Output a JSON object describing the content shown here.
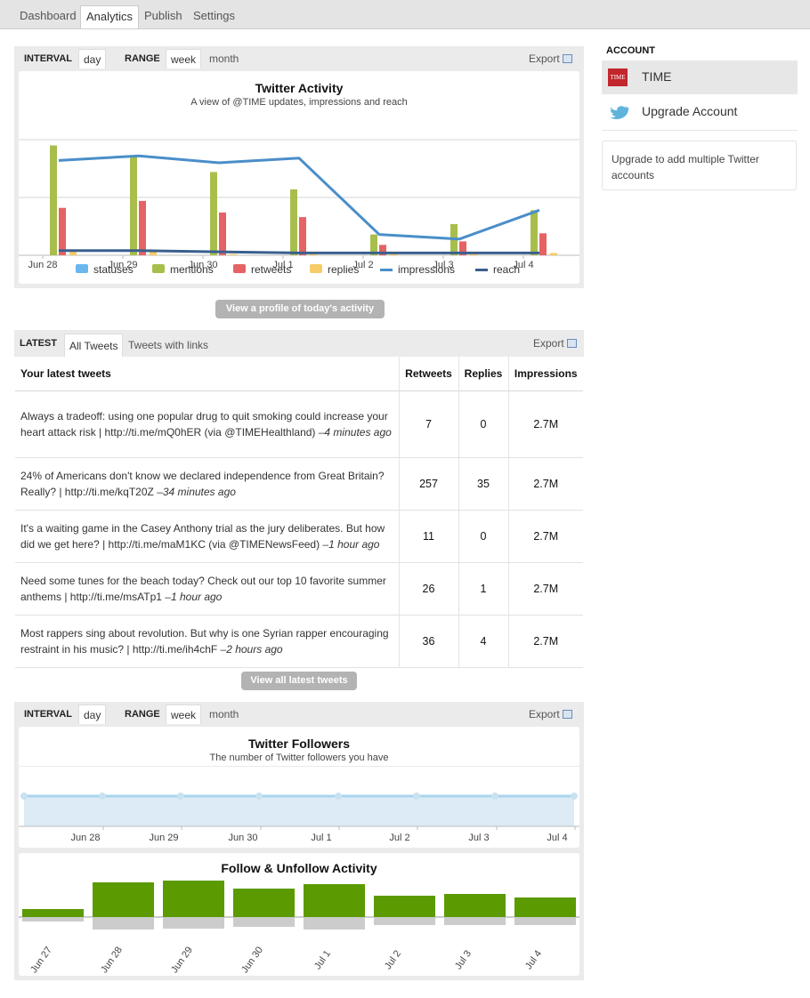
{
  "nav": {
    "tabs": [
      "Dashboard",
      "Analytics",
      "Publish",
      "Settings"
    ],
    "active": "Analytics"
  },
  "activity_panel": {
    "interval_label": "INTERVAL",
    "interval_value": "day",
    "range_label": "RANGE",
    "range_options": [
      "week",
      "month"
    ],
    "range_active": "week",
    "export_label": "Export",
    "chart_data": {
      "type": "bar",
      "title": "Twitter Activity",
      "subtitle": "A view of @TIME updates, impressions and reach",
      "categories": [
        "Jun 28",
        "Jun 29",
        "Jun 30",
        "Jul 1",
        "Jul 2",
        "Jul 3",
        "Jul 4"
      ],
      "grid": true,
      "legend_position": "bottom",
      "series": [
        {
          "name": "statuses",
          "type": "bar",
          "color": "#6ab7ef",
          "values": [
            0,
            0,
            0,
            0,
            0,
            0,
            0
          ]
        },
        {
          "name": "mentions",
          "type": "bar",
          "color": "#a8be4c",
          "values": [
            95,
            85,
            72,
            57,
            18,
            27,
            39
          ]
        },
        {
          "name": "retweets",
          "type": "bar",
          "color": "#e56363",
          "values": [
            41,
            47,
            37,
            33,
            9,
            12,
            19
          ]
        },
        {
          "name": "replies",
          "type": "bar",
          "color": "#f5cc68",
          "values": [
            3,
            3,
            1,
            1,
            1,
            1,
            2
          ]
        },
        {
          "name": "impressions",
          "type": "line",
          "color": "#4a8ec9",
          "values": [
            82,
            86,
            80,
            84,
            18,
            14,
            39
          ]
        },
        {
          "name": "reach",
          "type": "line",
          "color": "#3a5f8f",
          "values": [
            4,
            4,
            3,
            2,
            2,
            2,
            2
          ]
        }
      ]
    },
    "button": "View a profile of today's activity"
  },
  "latest": {
    "label": "LATEST",
    "tabs": [
      "All Tweets",
      "Tweets with links"
    ],
    "export_label": "Export",
    "columns": [
      "Your latest tweets",
      "Retweets",
      "Replies",
      "Impressions"
    ],
    "rows": [
      {
        "text": "Always a tradeoff: using one popular drug to quit smoking could increase your heart attack risk | http://ti.me/mQ0hER (via @TIMEHealthland) ",
        "time": "–4 minutes ago",
        "retweets": "7",
        "replies": "0",
        "impressions": "2.7M"
      },
      {
        "text": "24% of Americans don't know we declared independence from Great Britain? Really? | http://ti.me/kqT20Z ",
        "time": "–34 minutes ago",
        "retweets": "257",
        "replies": "35",
        "impressions": "2.7M"
      },
      {
        "text": "It's a waiting game in the Casey Anthony trial as the jury deliberates. But how did we get here? | http://ti.me/maM1KC (via @TIMENewsFeed) ",
        "time": "–1 hour ago",
        "retweets": "11",
        "replies": "0",
        "impressions": "2.7M"
      },
      {
        "text": "Need some tunes for the beach today? Check out our top 10 favorite summer anthems | http://ti.me/msATp1 ",
        "time": "–1 hour ago",
        "retweets": "26",
        "replies": "1",
        "impressions": "2.7M"
      },
      {
        "text": "Most rappers sing about revolution. But why is one Syrian rapper encouraging restraint in his music? | http://ti.me/ih4chF ",
        "time": "–2 hours ago",
        "retweets": "36",
        "replies": "4",
        "impressions": "2.7M"
      }
    ],
    "button": "View all latest tweets"
  },
  "followers_panel": {
    "interval_label": "INTERVAL",
    "interval_value": "day",
    "range_label": "RANGE",
    "range_options": [
      "week",
      "month"
    ],
    "range_active": "week",
    "export_label": "Export",
    "followers_chart": {
      "type": "area",
      "title": "Twitter Followers",
      "subtitle": "The number of Twitter followers you have",
      "categories": [
        "Jun 28",
        "Jun 29",
        "Jun 30",
        "Jul 1",
        "Jul 2",
        "Jul 3",
        "Jul 4"
      ],
      "color": "#a9d4ee"
    },
    "follow_chart": {
      "type": "bar",
      "title": "Follow & Unfollow Activity",
      "categories": [
        "Jun 27",
        "Jun 28",
        "Jun 29",
        "Jun 30",
        "Jul 1",
        "Jul 2",
        "Jul 3",
        "Jul 4"
      ],
      "series": [
        {
          "name": "follows",
          "color": "#5b9a00",
          "values": [
            9,
            39,
            41,
            32,
            37,
            24,
            26,
            22
          ]
        },
        {
          "name": "unfollows",
          "color": "#cccccc",
          "values": [
            -4,
            -13,
            -12,
            -10,
            -13,
            -8,
            -8,
            -8
          ]
        }
      ]
    }
  },
  "sidebar": {
    "title": "ACCOUNT",
    "accounts": [
      {
        "label": "TIME",
        "logo_text": "TIME"
      },
      {
        "label": "Upgrade Account"
      }
    ],
    "upgrade_text": "Upgrade to add multiple Twitter accounts"
  }
}
